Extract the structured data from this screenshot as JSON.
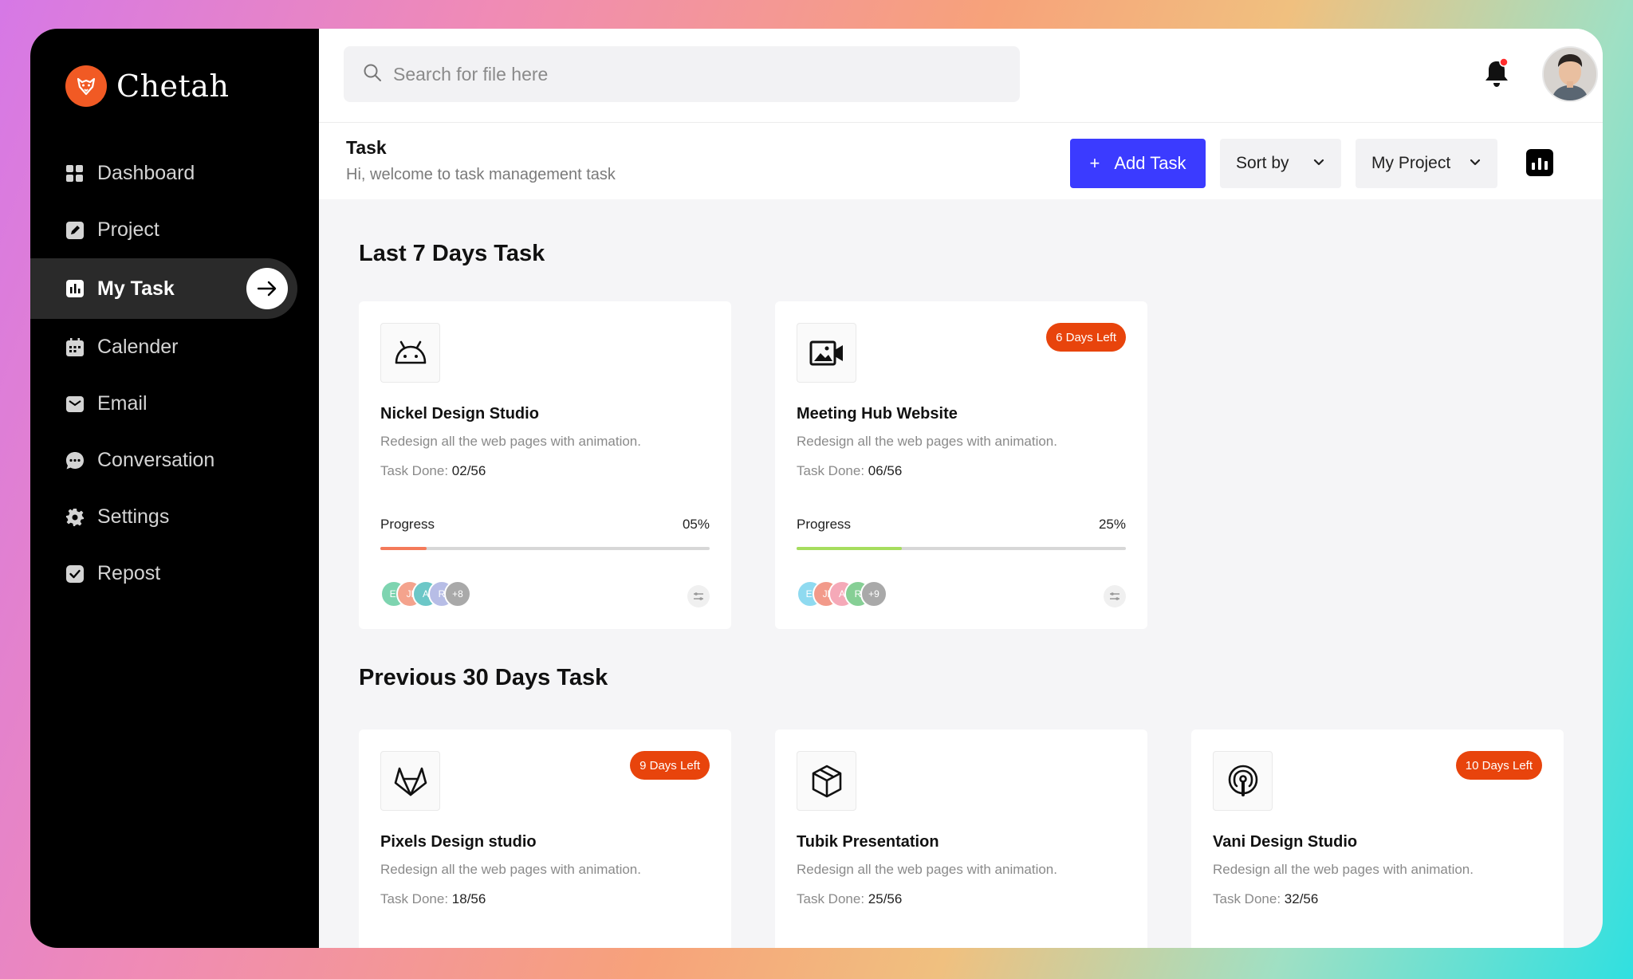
{
  "brand": {
    "name": "Chetah"
  },
  "sidebar": {
    "items": [
      {
        "label": "Dashboard",
        "icon": "grid-icon"
      },
      {
        "label": "Project",
        "icon": "edit-icon"
      },
      {
        "label": "My Task",
        "icon": "chart-icon",
        "active": true
      },
      {
        "label": "Calender",
        "icon": "calendar-icon"
      },
      {
        "label": "Email",
        "icon": "mail-icon"
      },
      {
        "label": "Conversation",
        "icon": "chat-icon"
      },
      {
        "label": "Settings",
        "icon": "gear-icon"
      },
      {
        "label": "Repost",
        "icon": "check-icon"
      }
    ]
  },
  "search": {
    "placeholder": "Search for file here",
    "value": ""
  },
  "header": {
    "title": "Task",
    "subtitle": "Hi, welcome to task management task",
    "add_label": "Add Task",
    "add_icon": "+",
    "sort_label": "Sort by",
    "project_label": "My Project"
  },
  "sections": {
    "recent_title": "Last 7 Days Task",
    "previous_title": "Previous 30 Days Task"
  },
  "recent_cards": [
    {
      "title": "Nickel Design Studio",
      "icon": "android-icon",
      "desc": "Redesign all the web pages with animation.",
      "done_label": "Task Done:",
      "done_value": "02/56",
      "progress_label": "Progress",
      "progress_text": "05%",
      "progress": 0.14,
      "progress_color": "#f47a5a",
      "members": [
        "El",
        "Jl",
        "A",
        "R"
      ],
      "more": "+8"
    },
    {
      "title": "Meeting Hub Website",
      "icon": "video-icon",
      "badge": "6 Days Left",
      "desc": "Redesign all the web pages with animation.",
      "done_label": "Task Done:",
      "done_value": "06/56",
      "progress_label": "Progress",
      "progress_text": "25%",
      "progress": 0.32,
      "progress_color": "#a6dd5e",
      "members": [
        "El",
        "Jl",
        "A",
        "R"
      ],
      "more": "+9"
    }
  ],
  "previous_cards": [
    {
      "title": "Pixels Design studio",
      "icon": "gitlab-icon",
      "badge": "9 Days Left",
      "desc": "Redesign all the web pages with animation.",
      "done_label": "Task Done:",
      "done_value": "18/56"
    },
    {
      "title": "Tubik Presentation",
      "icon": "box-icon",
      "desc": "Redesign all the web pages with animation.",
      "done_label": "Task Done:",
      "done_value": "25/56"
    },
    {
      "title": "Vani Design Studio",
      "icon": "podcast-icon",
      "badge": "10 Days Left",
      "desc": "Redesign all the web pages with animation.",
      "done_label": "Task Done:",
      "done_value": "32/56"
    }
  ],
  "colors": {
    "accent": "#3b3bff",
    "badge": "#e8440c",
    "brand": "#f15a24"
  }
}
